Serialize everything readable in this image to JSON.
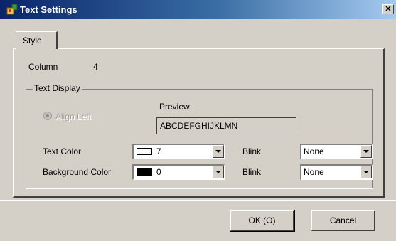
{
  "window": {
    "title": "Text Settings",
    "close_glyph": "✕",
    "icon": "settings-app-icon"
  },
  "tabs": [
    {
      "label": "Style",
      "selected": true
    }
  ],
  "column": {
    "label": "Column",
    "value": "4"
  },
  "text_display": {
    "group_label": "Text Display",
    "align": {
      "label": "Align Left",
      "checked": true,
      "enabled": false
    },
    "preview": {
      "label": "Preview",
      "text": "ABCDEFGHIJKLMN"
    },
    "text_color": {
      "label": "Text Color",
      "value": "7",
      "swatch": "#ffffff"
    },
    "text_blink": {
      "label": "Blink",
      "value": "None"
    },
    "background_color": {
      "label": "Background Color",
      "value": "0",
      "swatch": "#000000"
    },
    "background_blink": {
      "label": "Blink",
      "value": "None"
    }
  },
  "buttons": {
    "ok_text": "OK",
    "ok_accel": "(O)",
    "cancel": "Cancel"
  },
  "colors": {
    "title_start": "#0a246a",
    "title_end": "#a6caf0",
    "face": "#d4d0c8"
  }
}
